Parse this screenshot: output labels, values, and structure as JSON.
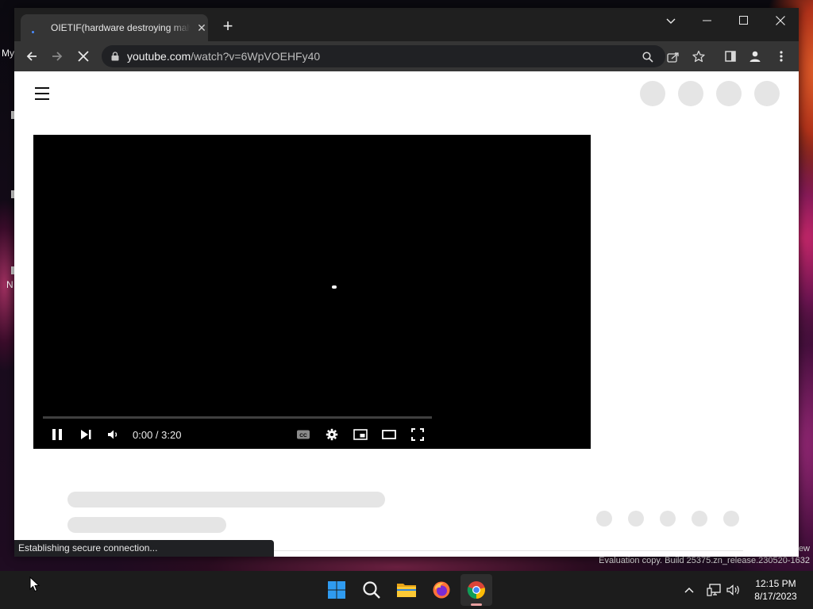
{
  "browser": {
    "tab": {
      "title": "OIETIF(hardware destroying malw",
      "close": "✕"
    },
    "new_tab": "+",
    "address": {
      "host": "youtube.com",
      "path": "/watch?v=6WpVOEHFy40"
    }
  },
  "player": {
    "time": "0:00 / 3:20",
    "progress": 0
  },
  "status_bar": "Establishing secure connection...",
  "desktop": {
    "labels": [
      "My",
      "N"
    ],
    "watermark_line1": "ew",
    "watermark_line2": "Evaluation copy. Build 25375.zn_release.230520-1632"
  },
  "taskbar": {
    "apps": [
      "windows-start",
      "search",
      "file-explorer",
      "firefox",
      "chrome"
    ],
    "clock_time": "12:15 PM",
    "clock_date": "8/17/2023"
  },
  "colors": {
    "chrome_dark": "#1f1f1f",
    "toolbar": "#353535",
    "skeleton": "#e5e5e5",
    "player_bg": "#000000"
  }
}
